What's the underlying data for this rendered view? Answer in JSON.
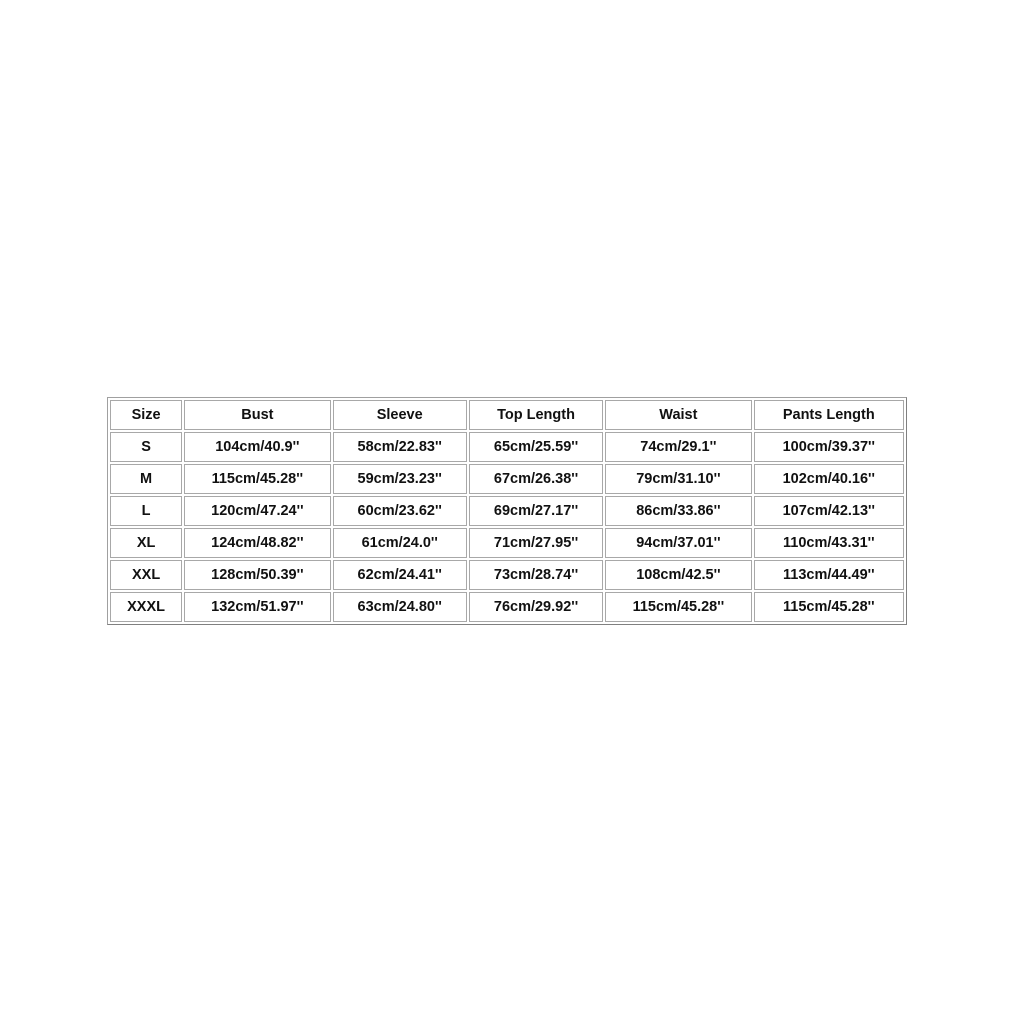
{
  "size_chart": {
    "headers": [
      "Size",
      "Bust",
      "Sleeve",
      "Top Length",
      "Waist",
      "Pants Length"
    ],
    "rows": [
      [
        "S",
        "104cm/40.9''",
        "58cm/22.83''",
        "65cm/25.59''",
        "74cm/29.1''",
        "100cm/39.37''"
      ],
      [
        "M",
        "115cm/45.28''",
        "59cm/23.23''",
        "67cm/26.38''",
        "79cm/31.10''",
        "102cm/40.16''"
      ],
      [
        "L",
        "120cm/47.24''",
        "60cm/23.62''",
        "69cm/27.17''",
        "86cm/33.86''",
        "107cm/42.13''"
      ],
      [
        "XL",
        "124cm/48.82''",
        "61cm/24.0''",
        "71cm/27.95''",
        "94cm/37.01''",
        "110cm/43.31''"
      ],
      [
        "XXL",
        "128cm/50.39''",
        "62cm/24.41''",
        "73cm/28.74''",
        "108cm/42.5''",
        "113cm/44.49''"
      ],
      [
        "XXXL",
        "132cm/51.97''",
        "63cm/24.80''",
        "76cm/29.92''",
        "115cm/45.28''",
        "115cm/45.28''"
      ]
    ]
  }
}
